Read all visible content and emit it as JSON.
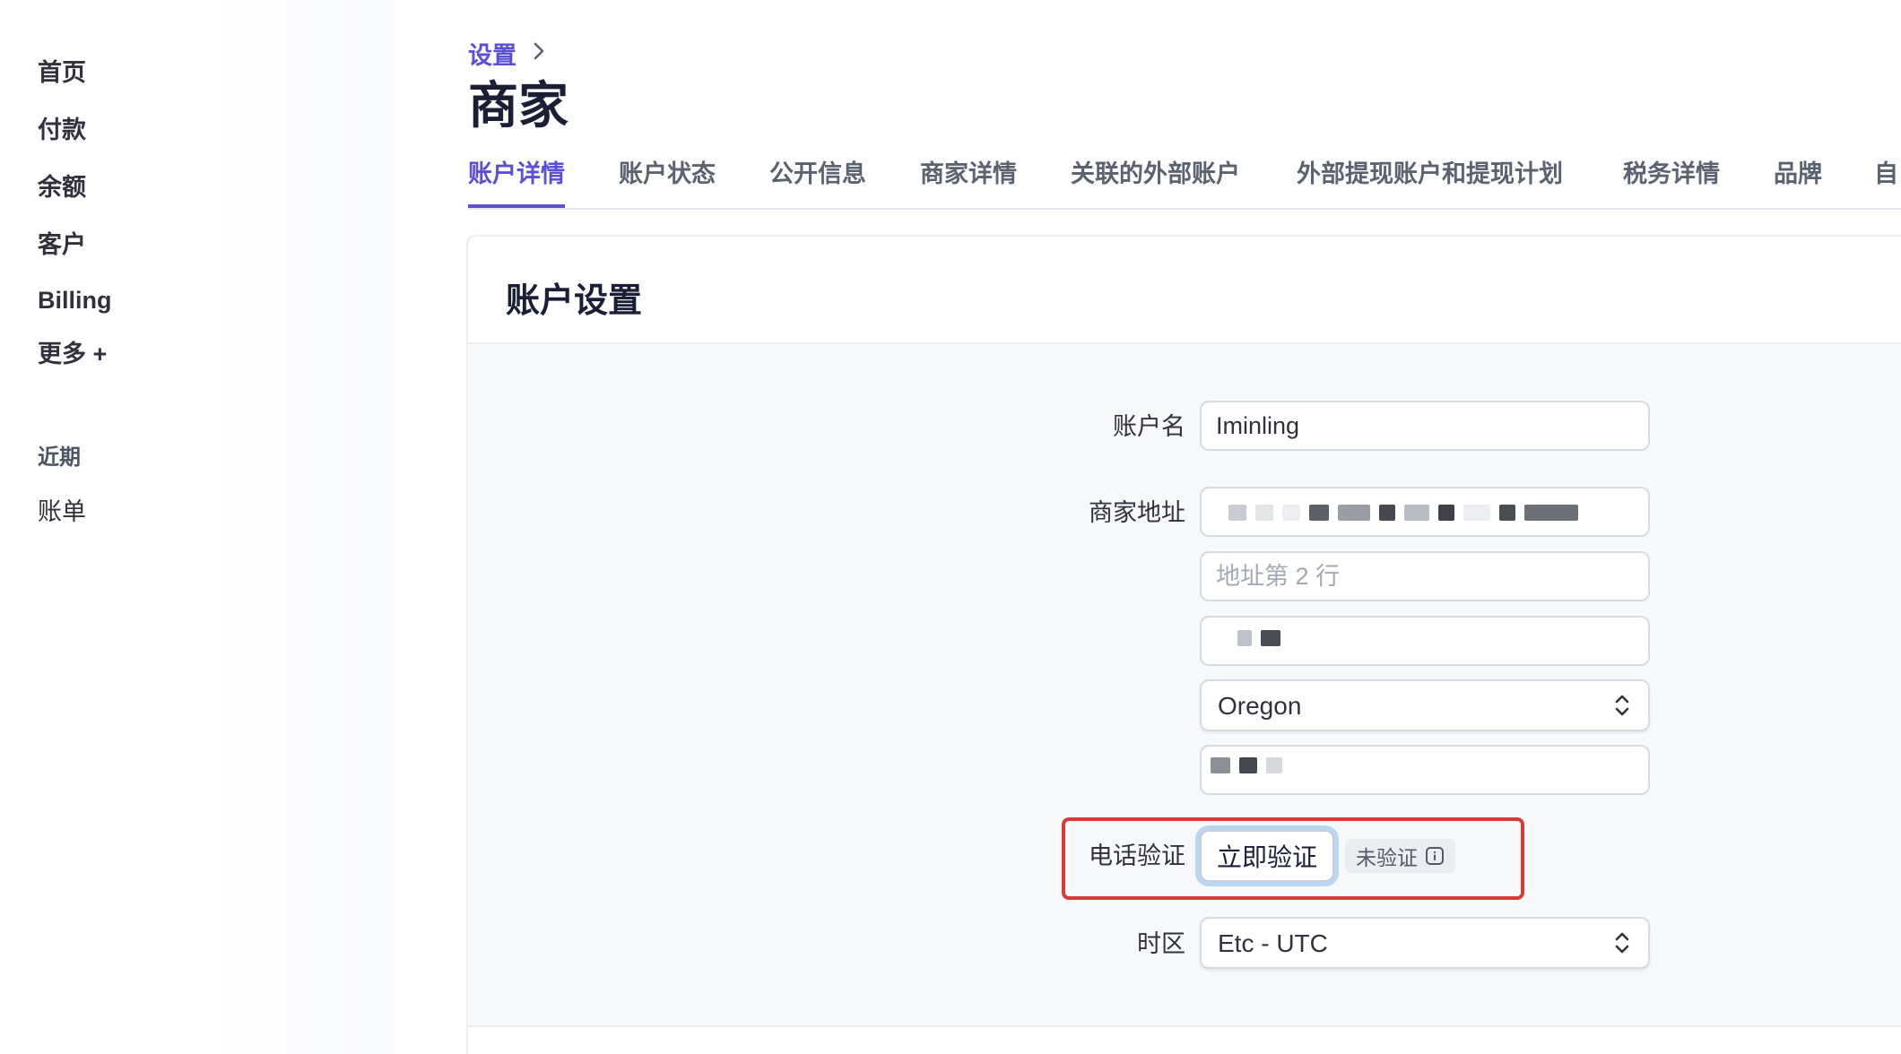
{
  "sidebar": {
    "items": [
      "首页",
      "付款",
      "余额",
      "客户",
      "Billing",
      "更多 +"
    ],
    "recent_heading": "近期",
    "recent_items": [
      "账单"
    ]
  },
  "header": {
    "breadcrumb": "设置",
    "title": "商家"
  },
  "tabs": [
    "账户详情",
    "账户状态",
    "公开信息",
    "商家详情",
    "关联的外部账户",
    "外部提现账户和提现计划",
    "税务详情",
    "品牌",
    "自"
  ],
  "active_tab": "账户详情",
  "card": {
    "title": "账户设置"
  },
  "form": {
    "account_name_label": "账户名",
    "account_name_value": "Iminling",
    "address_label": "商家地址",
    "address_line2_placeholder": "地址第 2 行",
    "state_value": "Oregon",
    "phone_label": "电话验证",
    "verify_button": "立即验证",
    "verify_status": "未验证",
    "timezone_label": "时区",
    "timezone_value": "Etc - UTC"
  },
  "colors": {
    "accent": "#5a4fd6",
    "highlight_box": "#d83b35",
    "focus_ring": "#b9d6f5"
  }
}
